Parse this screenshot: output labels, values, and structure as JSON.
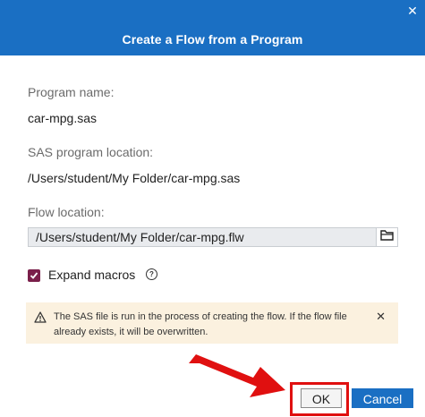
{
  "dialog": {
    "title": "Create a Flow from a Program",
    "close_icon": "close-icon"
  },
  "program": {
    "name_label": "Program name:",
    "name_value": "car-mpg.sas",
    "location_label": "SAS program location:",
    "location_value": "/Users/student/My Folder/car-mpg.sas"
  },
  "flow": {
    "location_label": "Flow location:",
    "location_value": "/Users/student/My Folder/car-mpg.flw",
    "browse_icon": "folder-icon"
  },
  "options": {
    "expand_macros_label": "Expand macros",
    "expand_macros_checked": true,
    "help_icon": "help-icon"
  },
  "warning": {
    "icon": "warning-icon",
    "text": "The SAS file is run in the process of creating the flow. If the flow file already exists, it will be overwritten.",
    "close_icon": "close-icon"
  },
  "buttons": {
    "ok_label": "OK",
    "cancel_label": "Cancel"
  },
  "colors": {
    "header": "#1a6fc3",
    "checkbox": "#7a1f4a",
    "warning_bg": "#fbf1df",
    "annotation": "#e01010"
  }
}
